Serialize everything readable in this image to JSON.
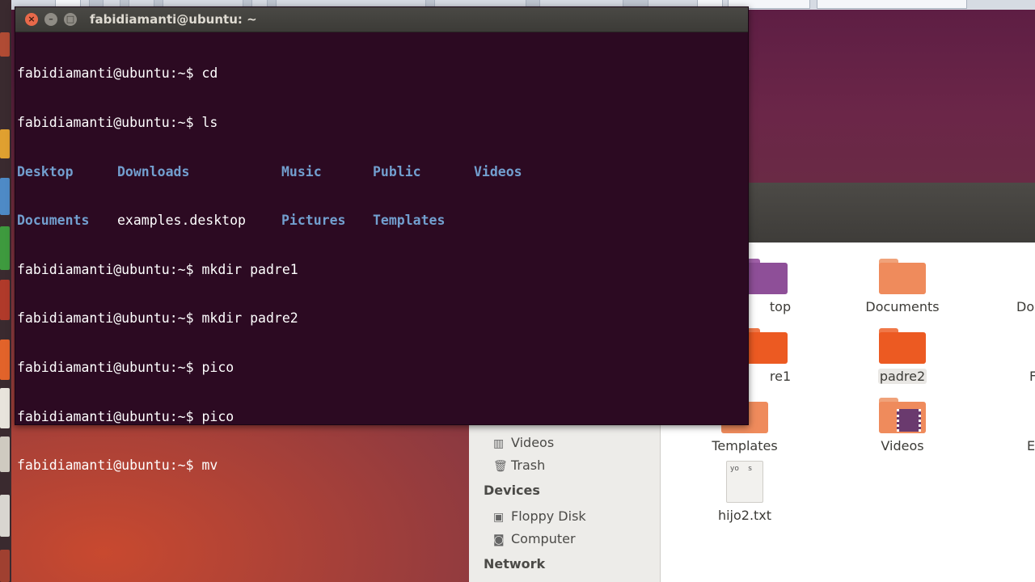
{
  "terminal": {
    "title": "fabidiamanti@ubuntu: ~",
    "prompt": "fabidiamanti@ubuntu:~$",
    "lines": [
      {
        "cmd": "cd"
      },
      {
        "cmd": "ls"
      },
      {
        "cmd": "mkdir padre1"
      },
      {
        "cmd": "mkdir padre2"
      },
      {
        "cmd": "pico"
      },
      {
        "cmd": "pico"
      },
      {
        "cmd": "mv"
      }
    ],
    "ls_row1": [
      "Desktop",
      "Downloads",
      "Music",
      "Public",
      "Videos"
    ],
    "ls_row2": [
      "Documents",
      "examples.desktop",
      "Pictures",
      "Templates"
    ],
    "colors": {
      "background": "#2c0a22",
      "dir": "#729fcf",
      "text": "#ffffff"
    }
  },
  "files_sidebar": {
    "items_top": [
      {
        "label": "Videos",
        "icon": "film-icon"
      },
      {
        "label": "Trash",
        "icon": "trash-icon"
      }
    ],
    "devices_heading": "Devices",
    "devices": [
      {
        "label": "Floppy Disk",
        "icon": "floppy-icon"
      },
      {
        "label": "Computer",
        "icon": "computer-icon"
      }
    ],
    "network_heading": "Network"
  },
  "files_grid": {
    "items": [
      {
        "label": "top"
      },
      {
        "label": "Documents"
      },
      {
        "label": "Do"
      },
      {
        "label": "re1"
      },
      {
        "label": "padre2"
      },
      {
        "label": "F"
      },
      {
        "label": "Templates"
      },
      {
        "label": "Videos"
      },
      {
        "label": "E"
      },
      {
        "label": "hijo2.txt"
      }
    ],
    "text_file_preview": "yo    s"
  }
}
